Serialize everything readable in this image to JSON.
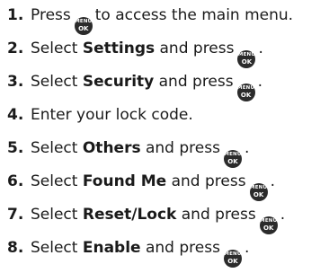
{
  "key_icon": {
    "top": "MENU",
    "bottom": "OK",
    "color": "#2b2b2b"
  },
  "steps": [
    {
      "num": "1.",
      "a": "Press",
      "b": "to access the main menu."
    },
    {
      "num": "2.",
      "a": "Select",
      "bold": "Settings",
      "b": "and press",
      "end": "."
    },
    {
      "num": "3.",
      "a": "Select",
      "bold": "Security",
      "b": "and press",
      "end": "."
    },
    {
      "num": "4.",
      "a": "Enter your lock code."
    },
    {
      "num": "5.",
      "a": "Select",
      "bold": "Others",
      "b": "and press",
      "end": "."
    },
    {
      "num": "6.",
      "a": "Select",
      "bold": "Found Me",
      "b": "and press",
      "end": "."
    },
    {
      "num": "7.",
      "a": "Select",
      "bold": "Reset/Lock",
      "b": "and press",
      "end": "."
    },
    {
      "num": "8.",
      "a": "Select",
      "bold": "Enable",
      "b": "and press",
      "end": "."
    }
  ]
}
